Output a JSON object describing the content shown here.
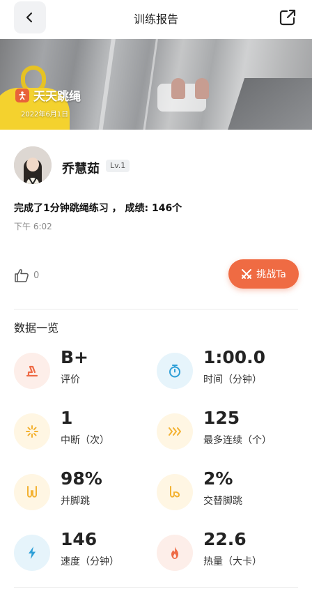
{
  "header": {
    "title": "训练报告"
  },
  "banner": {
    "brand_name": "天天跳绳",
    "date": "2022年6月1日"
  },
  "user": {
    "name": "乔慧茹",
    "level": "Lv.1"
  },
  "record": {
    "summary": "完成了1分钟跳绳练习 ， 成绩: 146个",
    "time": "下午 6:02"
  },
  "actions": {
    "like_count": "0",
    "challenge_label": "挑战Ta"
  },
  "stats_section": {
    "title": "数据一览",
    "items": [
      {
        "value": "B+",
        "label": "评价",
        "icon": "rating-icon",
        "color": "#ee6a45",
        "bg": "#fdeee9"
      },
      {
        "value": "1:00.0",
        "label": "时间（分钟）",
        "icon": "stopwatch-icon",
        "color": "#2e9fd7",
        "bg": "#e6f4fb"
      },
      {
        "value": "1",
        "label": "中断（次）",
        "icon": "interruption-icon",
        "color": "#f3b232",
        "bg": "#fff6e3"
      },
      {
        "value": "125",
        "label": "最多连续（个）",
        "icon": "streak-icon",
        "color": "#f3b232",
        "bg": "#fff6e3"
      },
      {
        "value": "98%",
        "label": "并脚跳",
        "icon": "feet-together-icon",
        "color": "#f3b232",
        "bg": "#fff6e3"
      },
      {
        "value": "2%",
        "label": "交替脚跳",
        "icon": "alternate-feet-icon",
        "color": "#f3b232",
        "bg": "#fff6e3"
      },
      {
        "value": "146",
        "label": "速度（分钟）",
        "icon": "lightning-icon",
        "color": "#2e9fd7",
        "bg": "#e6f4fb"
      },
      {
        "value": "22.6",
        "label": "热量（大卡）",
        "icon": "flame-icon",
        "color": "#ee6a45",
        "bg": "#fdeee9"
      }
    ]
  }
}
